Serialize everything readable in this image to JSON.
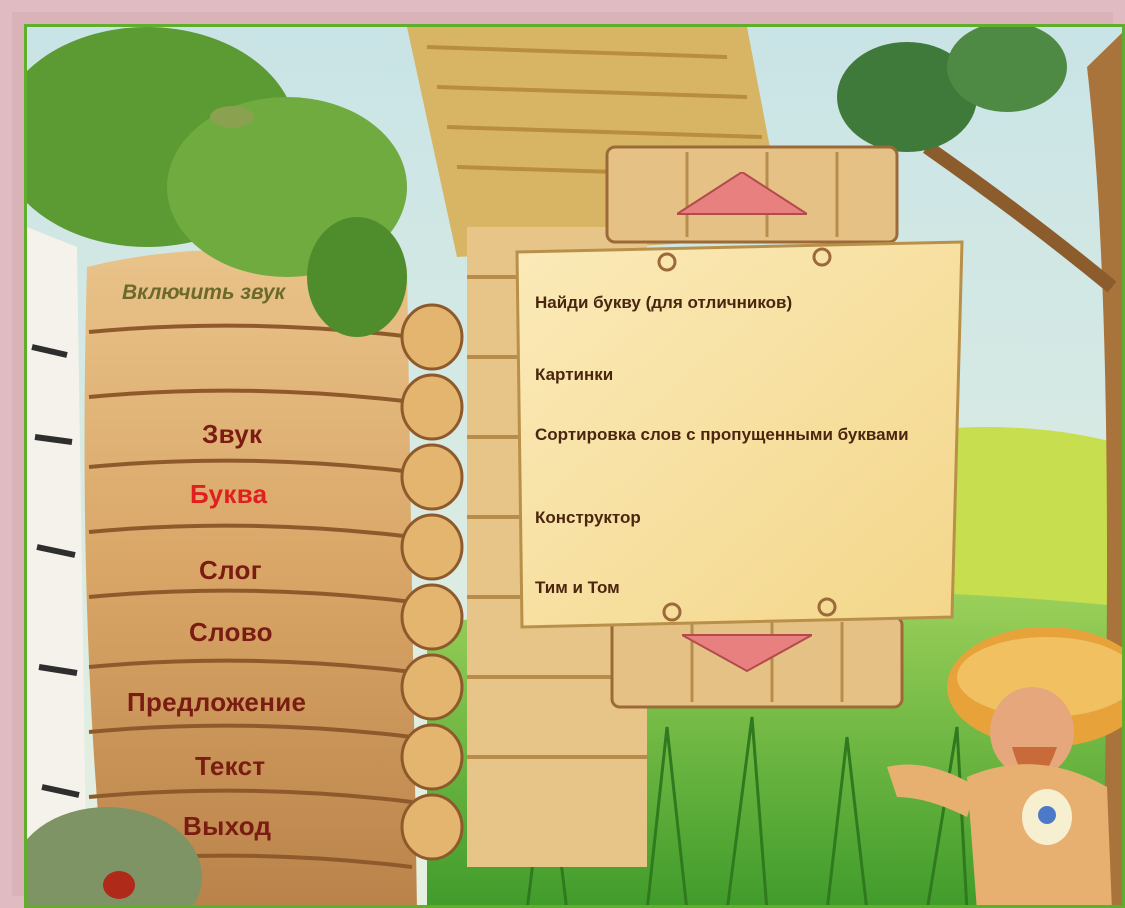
{
  "sound_toggle": "Включить звук",
  "main_menu": {
    "items": [
      {
        "label": "Звук",
        "active": false
      },
      {
        "label": "Буква",
        "active": true
      },
      {
        "label": "Слог",
        "active": false
      },
      {
        "label": "Слово",
        "active": false
      },
      {
        "label": "Предложение",
        "active": false
      },
      {
        "label": "Текст",
        "active": false
      },
      {
        "label": "Выход",
        "active": false
      }
    ]
  },
  "submenu": {
    "items": [
      {
        "label": "Найди букву (для отличников)"
      },
      {
        "label": "Картинки"
      },
      {
        "label": "Сортировка слов с пропущенными буквами"
      },
      {
        "label": "Конструктор"
      },
      {
        "label": "Тим и Том"
      }
    ],
    "scroll_up_icon": "triangle-up-icon",
    "scroll_down_icon": "triangle-down-icon"
  },
  "colors": {
    "frame": "#e0bcc2",
    "border": "#5fae2c",
    "menu_text": "#7a1c12",
    "menu_active": "#e02020",
    "sound_text": "#6c6a2a",
    "scroll_text": "#4a2610",
    "arrow": "#e88080"
  }
}
